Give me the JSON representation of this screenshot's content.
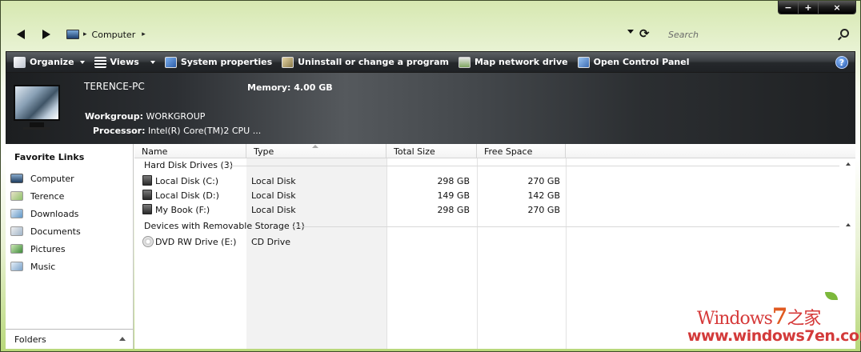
{
  "window": {
    "caption": {
      "minimize": "−",
      "maximize": "+",
      "close": "×"
    }
  },
  "address_bar": {
    "location": "Computer",
    "search_placeholder": "Search"
  },
  "command_bar": {
    "organize": "Organize",
    "views": "Views",
    "system_properties": "System properties",
    "uninstall": "Uninstall or change a program",
    "map_network_drive": "Map network drive",
    "open_control_panel": "Open Control Panel",
    "help": "?"
  },
  "details_pane": {
    "computer_name": "TERENCE-PC",
    "memory_label": "Memory:",
    "memory_value": "4.00 GB",
    "workgroup_label": "Workgroup:",
    "workgroup_value": "WORKGROUP",
    "processor_label": "Processor:",
    "processor_value": "Intel(R) Core(TM)2 CPU ..."
  },
  "sidebar": {
    "title": "Favorite Links",
    "items": [
      {
        "label": "Computer",
        "icon": "computer-icon"
      },
      {
        "label": "Terence",
        "icon": "user-folder-icon"
      },
      {
        "label": "Downloads",
        "icon": "downloads-icon"
      },
      {
        "label": "Documents",
        "icon": "documents-icon"
      },
      {
        "label": "Pictures",
        "icon": "pictures-icon"
      },
      {
        "label": "Music",
        "icon": "music-icon"
      }
    ],
    "folders_label": "Folders"
  },
  "file_list": {
    "columns": [
      "Name",
      "Type",
      "Total Size",
      "Free Space"
    ],
    "groups": [
      {
        "label": "Hard Disk Drives (3)",
        "rows": [
          {
            "name": "Local Disk (C:)",
            "type": "Local Disk",
            "total": "298 GB",
            "free": "270 GB"
          },
          {
            "name": "Local Disk (D:)",
            "type": "Local Disk",
            "total": "149 GB",
            "free": "142 GB"
          },
          {
            "name": "My Book (F:)",
            "type": "Local Disk",
            "total": "298 GB",
            "free": "270 GB"
          }
        ]
      },
      {
        "label": "Devices with Removable Storage (1)",
        "rows": [
          {
            "name": "DVD RW Drive (E:)",
            "type": "CD Drive",
            "total": "",
            "free": ""
          }
        ]
      }
    ]
  },
  "watermark": {
    "logo_prefix": "Windows",
    "logo_seven": "7",
    "logo_suffix": "之家",
    "url": "www.windows7en.com"
  },
  "colors": {
    "command_bar": "#2b2e31",
    "details_pane": "#3a3d41",
    "watermark_red": "#d33a3a"
  }
}
